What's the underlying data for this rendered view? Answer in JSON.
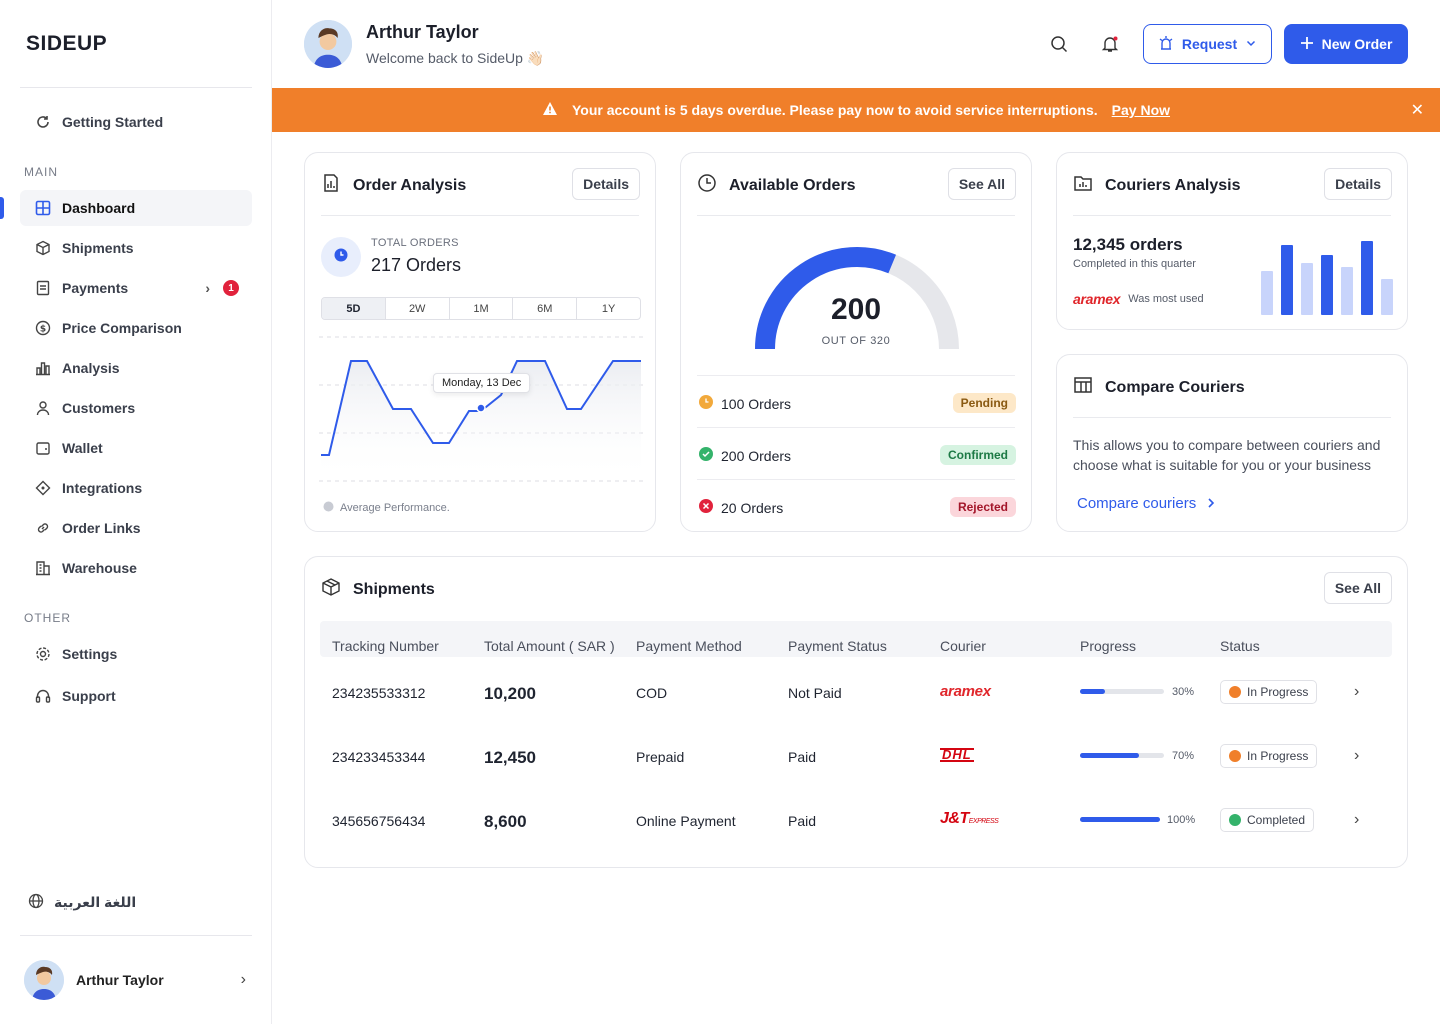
{
  "brand": {
    "logo": "SIDEUP"
  },
  "sidebar": {
    "getting_started": "Getting Started",
    "main_label": "MAIN",
    "other_label": "OTHER",
    "items": [
      {
        "label": "Dashboard"
      },
      {
        "label": "Shipments"
      },
      {
        "label": "Payments",
        "badge": "1"
      },
      {
        "label": "Price Comparison"
      },
      {
        "label": "Analysis"
      },
      {
        "label": "Customers"
      },
      {
        "label": "Wallet"
      },
      {
        "label": "Integrations"
      },
      {
        "label": "Order Links"
      },
      {
        "label": "Warehouse"
      }
    ],
    "other_items": [
      {
        "label": "Settings"
      },
      {
        "label": "Support"
      }
    ],
    "language": "اللغة العربية",
    "profile_name": "Arthur Taylor"
  },
  "header": {
    "name": "Arthur Taylor",
    "welcome": "Welcome back to SideUp 👋🏻",
    "request_label": "Request",
    "new_order_label": "New Order"
  },
  "alert": {
    "message": "Your account is 5 days overdue. Please pay now to avoid service interruptions.",
    "pay_now": "Pay Now"
  },
  "order_analysis": {
    "title": "Order Analysis",
    "details": "Details",
    "total_label": "TOTAL ORDERS",
    "total_value": "217 Orders",
    "ranges": [
      "5D",
      "2W",
      "1M",
      "6M",
      "1Y"
    ],
    "selected_range": "5D",
    "tooltip": "Monday, 13 Dec",
    "footer": "Average Performance."
  },
  "available_orders": {
    "title": "Available Orders",
    "see_all": "See All",
    "value": "200",
    "out_of": "OUT OF 320",
    "value_num": 200,
    "max_num": 320,
    "rows": [
      {
        "label": "100 Orders",
        "tag": "Pending"
      },
      {
        "label": "200 Orders",
        "tag": "Confirmed"
      },
      {
        "label": "20 Orders",
        "tag": "Rejected"
      }
    ]
  },
  "couriers_analysis": {
    "title": "Couriers Analysis",
    "details": "Details",
    "orders": "12,345 orders",
    "sub": "Completed in this quarter",
    "brand": "aramex",
    "most_used": "Was most used"
  },
  "compare": {
    "title": "Compare Couriers",
    "text": "This allows you to compare between couriers and choose what is suitable for you or your business",
    "link": "Compare couriers"
  },
  "shipments": {
    "title": "Shipments",
    "see_all": "See All",
    "headers": [
      "Tracking Number",
      "Total Amount ( SAR )",
      "Payment Method",
      "Payment Status",
      "Courier",
      "Progress",
      "Status"
    ],
    "rows": [
      {
        "tracking": "234235533312",
        "amount": "10,200",
        "method": "COD",
        "pstatus": "Not Paid",
        "courier": "aramex",
        "progress": 30,
        "progress_label": "30%",
        "status": "In Progress"
      },
      {
        "tracking": "234233453344",
        "amount": "12,450",
        "method": "Prepaid",
        "pstatus": "Paid",
        "courier": "DHL",
        "progress": 70,
        "progress_label": "70%",
        "status": "In Progress"
      },
      {
        "tracking": "345656756434",
        "amount": "8,600",
        "method": "Online Payment",
        "pstatus": "Paid",
        "courier": "J&T",
        "courier_sub": "EXPRESS",
        "progress": 100,
        "progress_label": "100%",
        "status": "Completed"
      }
    ]
  },
  "colors": {
    "primary": "#2f5bea",
    "alert": "#f07f2a",
    "pending": "#f2a93b",
    "confirmed": "#34b36b",
    "rejected": "#e1223c",
    "aramex": "#e0262b",
    "dhl": "#d40511"
  }
}
